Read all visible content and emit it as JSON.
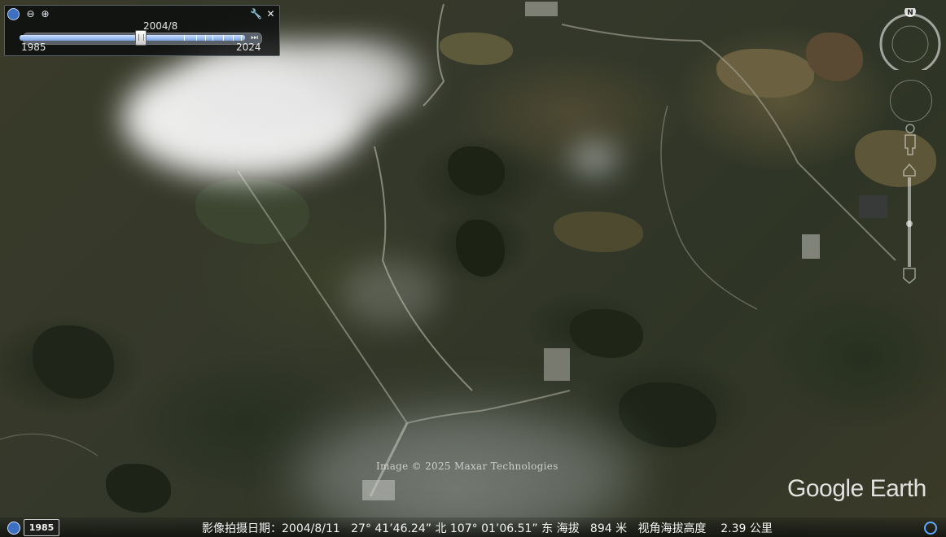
{
  "time_slider": {
    "current_date": "2004/8",
    "start_year": "1985",
    "end_year": "2024",
    "position_fraction": 0.49,
    "icons": [
      "clock-icon",
      "zoom-out-icon",
      "zoom-in-icon",
      "wrench-icon",
      "close-icon"
    ]
  },
  "navigation": {
    "north_label": "N",
    "icons": [
      "compass-icon",
      "look-around-icon",
      "pegman-icon",
      "zoom-slider-icon"
    ]
  },
  "map": {
    "copyright": "Image © 2025 Maxar Technologies",
    "logo": "Google Earth"
  },
  "status_bar": {
    "history_year": "1985",
    "text": "影像拍摄日期：2004/8/11   27° 41’46.24” 北 107° 01’06.51” 东 海拔   894 米   视角海拔高度    2.39 公里"
  },
  "colors": {
    "slider_fill": "#7aa3e0",
    "accent": "#3d6fc2"
  }
}
